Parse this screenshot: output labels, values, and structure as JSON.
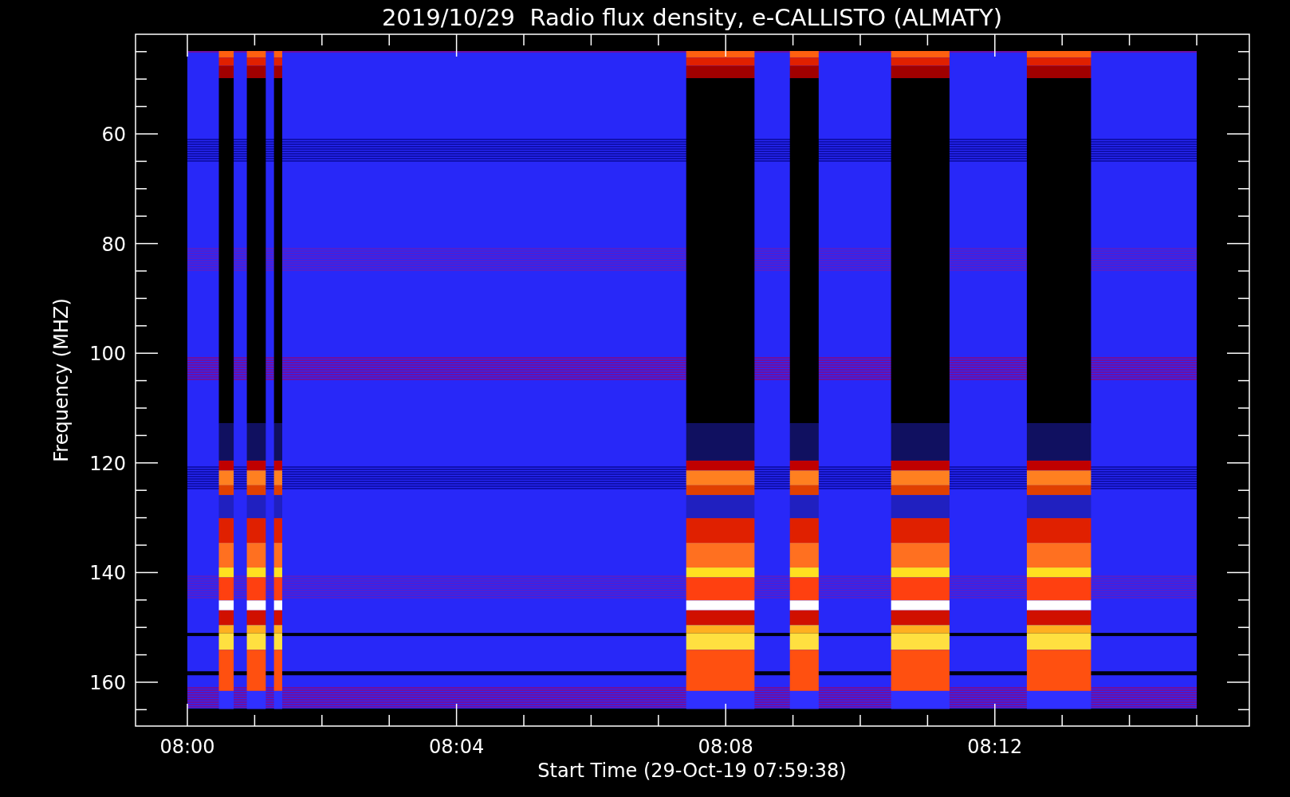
{
  "plot": {
    "title": "2019/10/29  Radio flux density, e-CALLISTO (ALMATY)",
    "x_axis": {
      "label": "Start Time (29-Oct-19 07:59:38)",
      "ticks": [
        "08:00",
        "08:04",
        "08:08",
        "08:12"
      ]
    },
    "y_axis": {
      "label": "Frequency (MHZ)",
      "ticks": [
        "60",
        "80",
        "100",
        "120",
        "140",
        "160"
      ]
    }
  }
}
